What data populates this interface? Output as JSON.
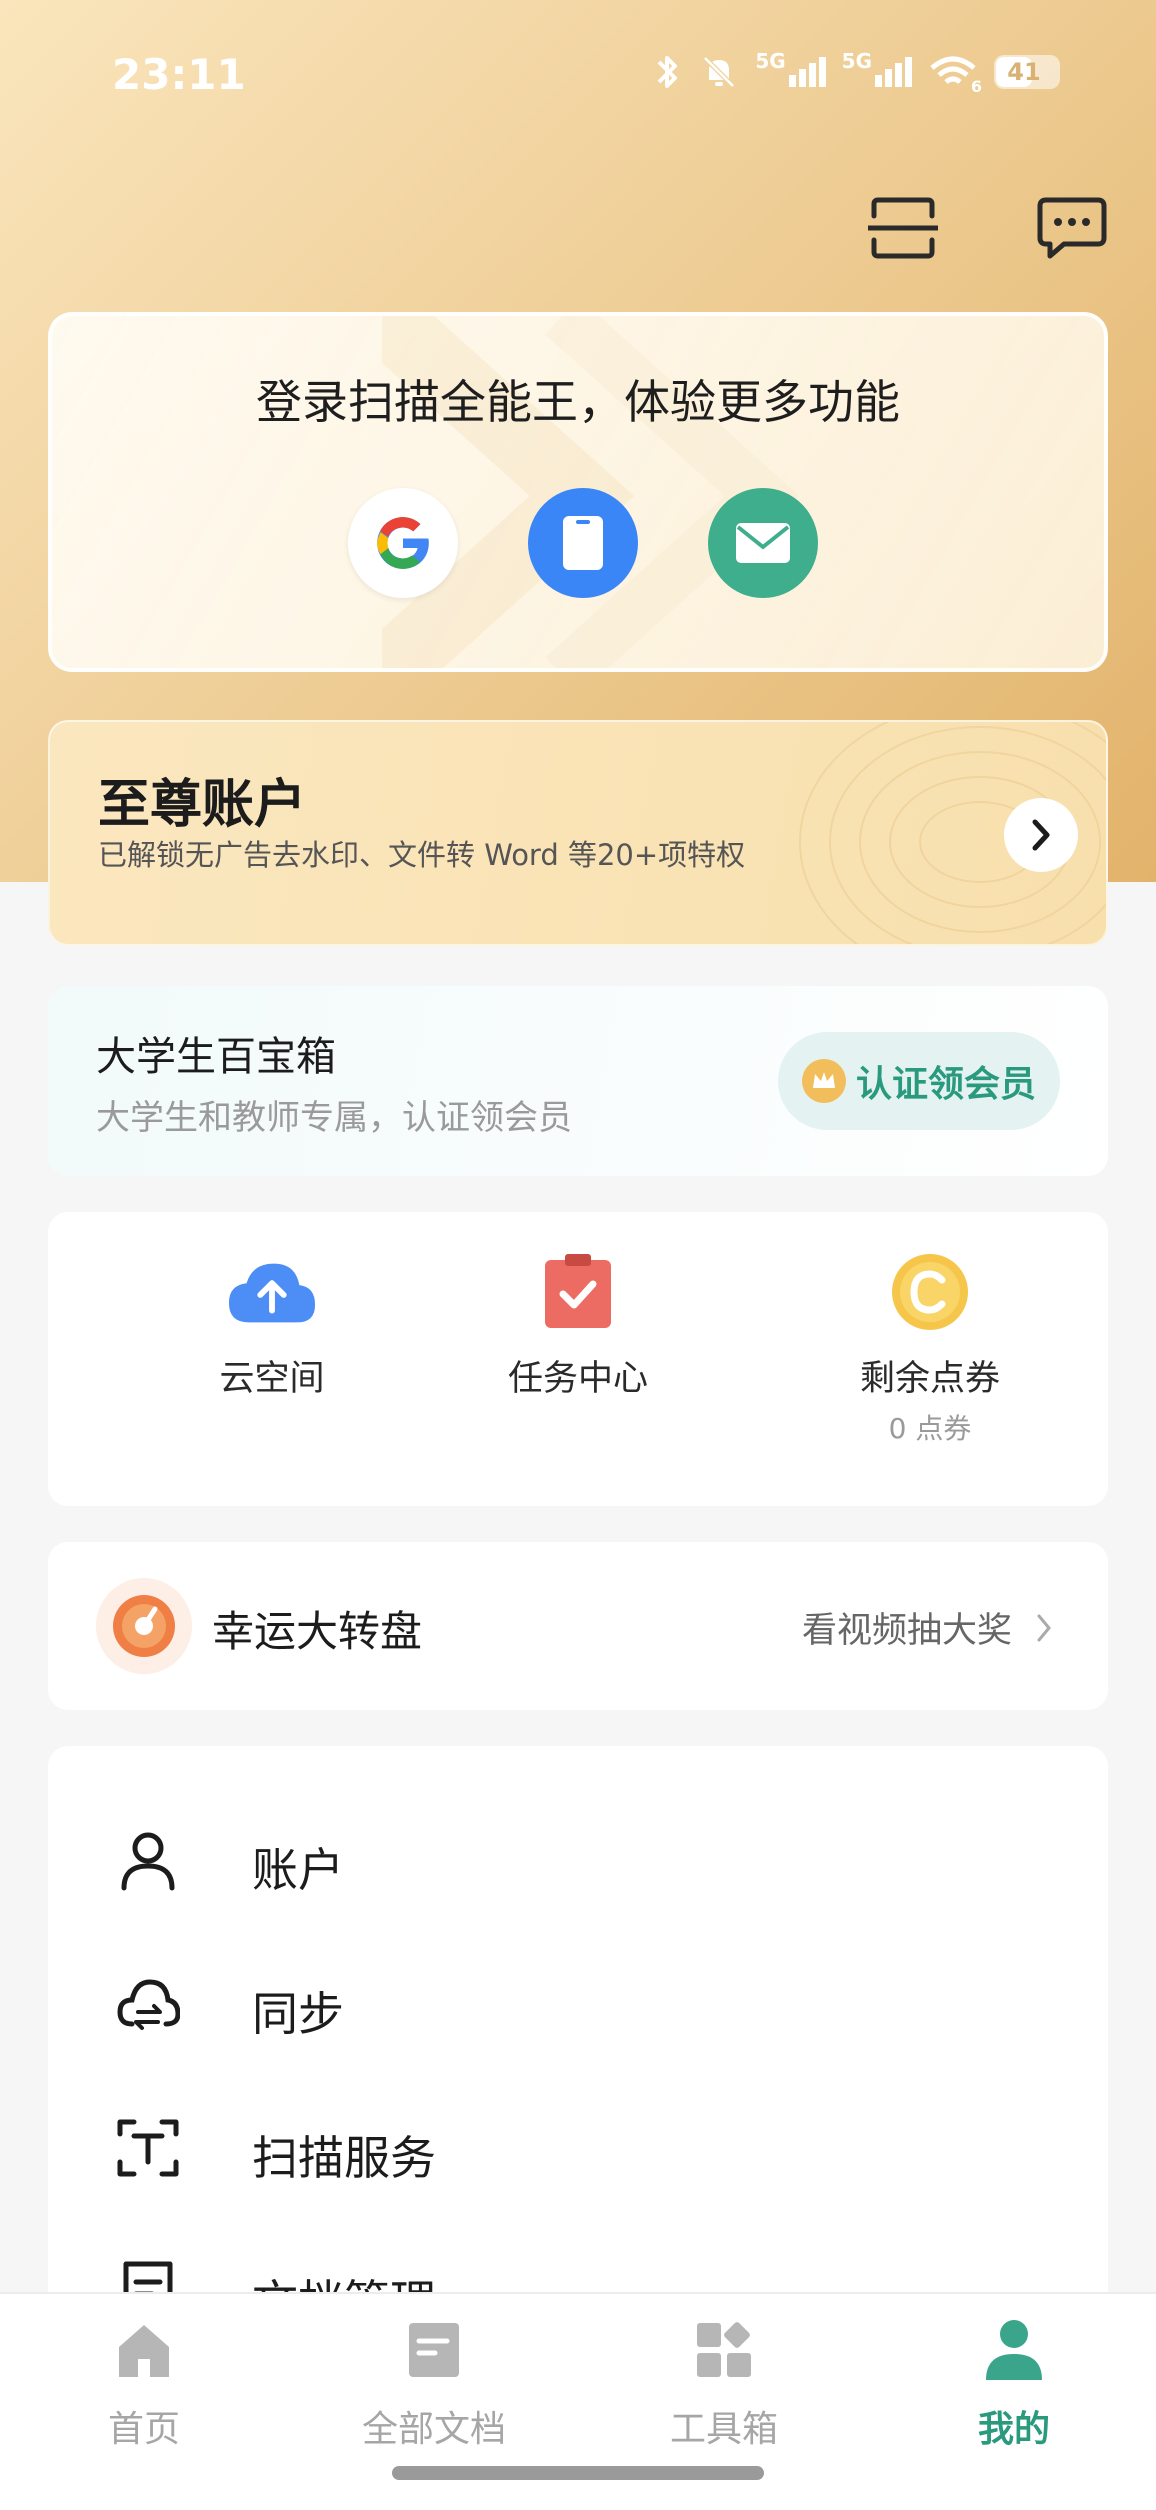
{
  "status_bar": {
    "time": "23:11",
    "net1": "5G",
    "net2": "5G",
    "wifi_badge": "6",
    "battery": "41"
  },
  "login": {
    "title": "登录扫描全能王，体验更多功能",
    "methods": [
      "google-icon",
      "phone-icon",
      "mail-icon"
    ]
  },
  "vip": {
    "title": "至尊账户",
    "subtitle": "已解锁无广告去水印、文件转 Word 等20+项特权"
  },
  "edu": {
    "title": "大学生百宝箱",
    "subtitle": "大学生和教师专属，认证领会员",
    "button": "认证领会员"
  },
  "quick": [
    {
      "label": "云空间",
      "icon": "cloud-upload-icon"
    },
    {
      "label": "任务中心",
      "icon": "task-clipboard-icon"
    },
    {
      "label": "剩余点券",
      "sub": "0 点券",
      "icon": "coin-icon"
    }
  ],
  "wheel": {
    "title": "幸运大转盘",
    "right": "看视频抽大奖"
  },
  "menu": [
    {
      "label": "账户",
      "icon": "user-icon"
    },
    {
      "label": "同步",
      "icon": "cloud-sync-icon"
    },
    {
      "label": "扫描服务",
      "icon": "scan-text-icon"
    },
    {
      "label": "文档管理",
      "icon": "document-icon"
    }
  ],
  "tabs": [
    {
      "label": "首页",
      "icon": "home-icon"
    },
    {
      "label": "全部文档",
      "icon": "docs-icon"
    },
    {
      "label": "工具箱",
      "icon": "toolbox-icon"
    },
    {
      "label": "我的",
      "icon": "profile-icon",
      "active": true
    }
  ],
  "colors": {
    "accent": "#2a9a7f",
    "gold": "#e2b36b",
    "phone_blue": "#3b86f6",
    "mail_green": "#3fae8d"
  }
}
